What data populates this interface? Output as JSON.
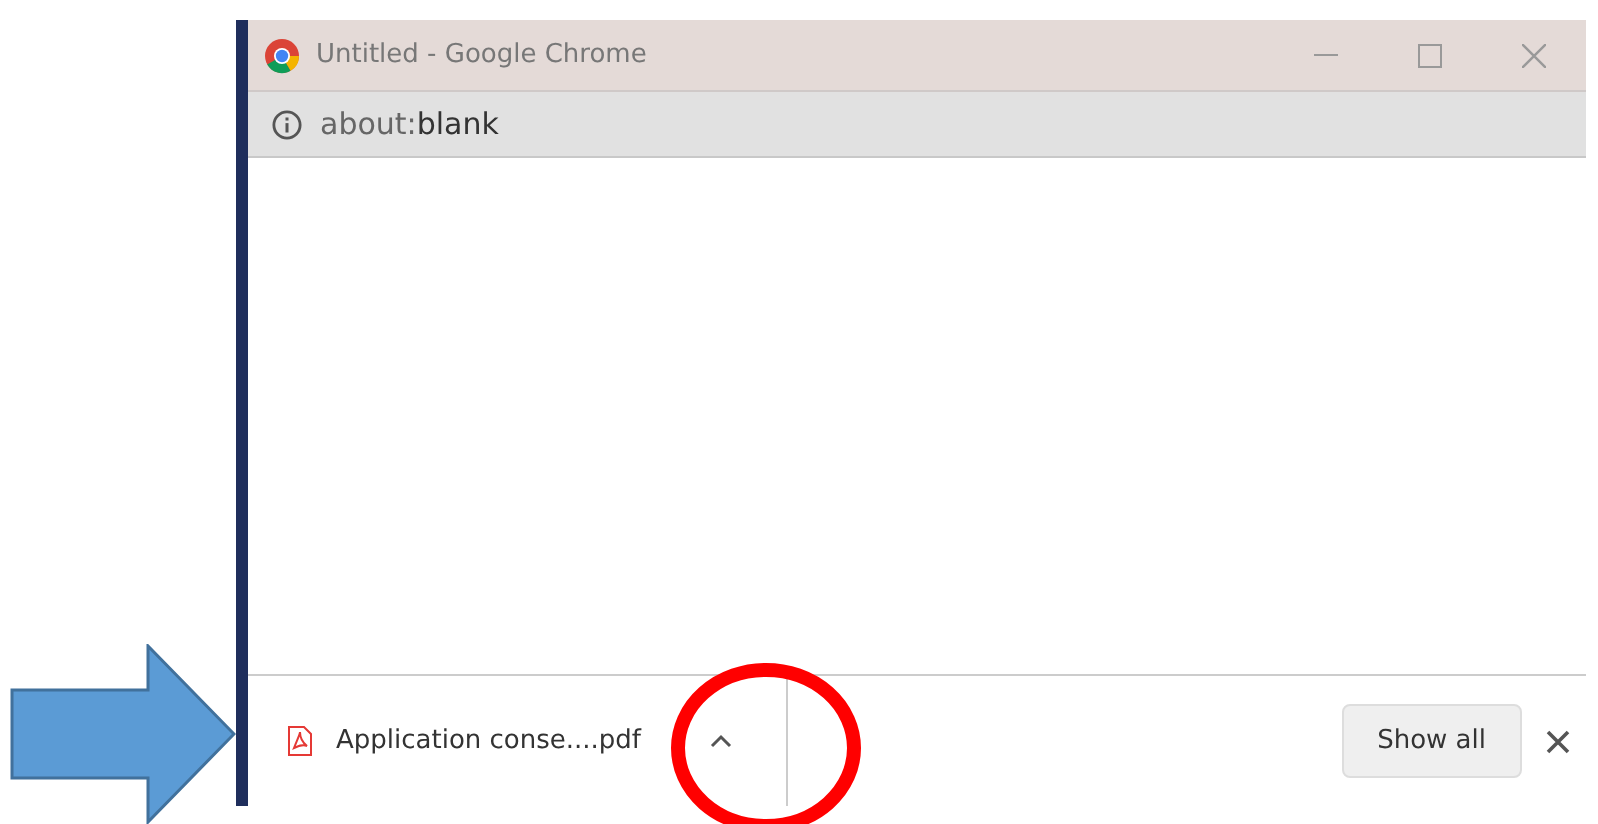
{
  "window": {
    "title": "Untitled - Google Chrome"
  },
  "address_bar": {
    "scheme": "about:",
    "path": "blank"
  },
  "download_shelf": {
    "file_name": "Application conse....pdf",
    "show_all_button": "Show all"
  }
}
